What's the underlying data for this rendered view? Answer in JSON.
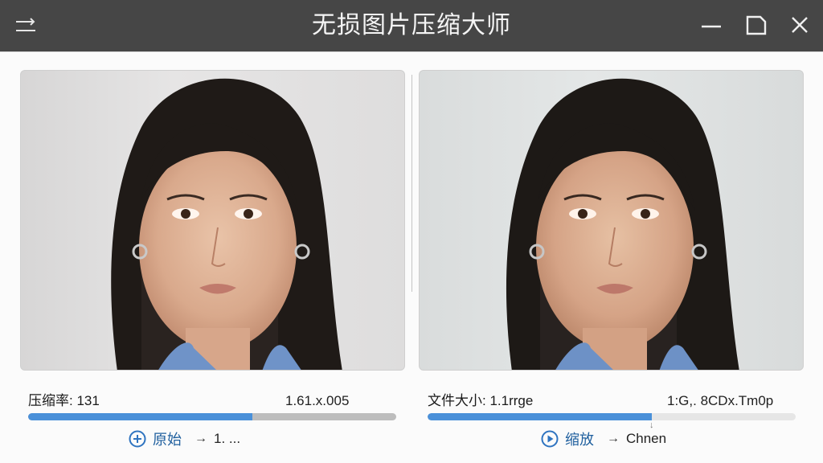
{
  "app": {
    "title": "无损图片压缩大师"
  },
  "left_panel": {
    "stat_label": "压缩率: 131",
    "stat_value": "1.61.x.005",
    "progress": 0.61,
    "action_label": "原始",
    "action_arrow": "→",
    "action_target": "1. ..."
  },
  "right_panel": {
    "stat_label": "文件大小: 1.1rrge",
    "stat_value": "1:G,. 8CDx.Tm0p",
    "progress": 0.61,
    "action_label": "缩放",
    "action_arrow": "→",
    "action_target": "Chnen",
    "slider_marker": "↓"
  },
  "colors": {
    "titlebar": "#464646",
    "accent": "#4a90d9",
    "track_left": "#bdbdbd",
    "track_right": "#e6e6e6"
  },
  "icons": {
    "menu": "menu-swap-icon",
    "minimize": "minimize-icon",
    "maximize": "maximize-icon",
    "close": "close-icon",
    "add": "plus-circle-icon",
    "play": "play-circle-icon"
  }
}
